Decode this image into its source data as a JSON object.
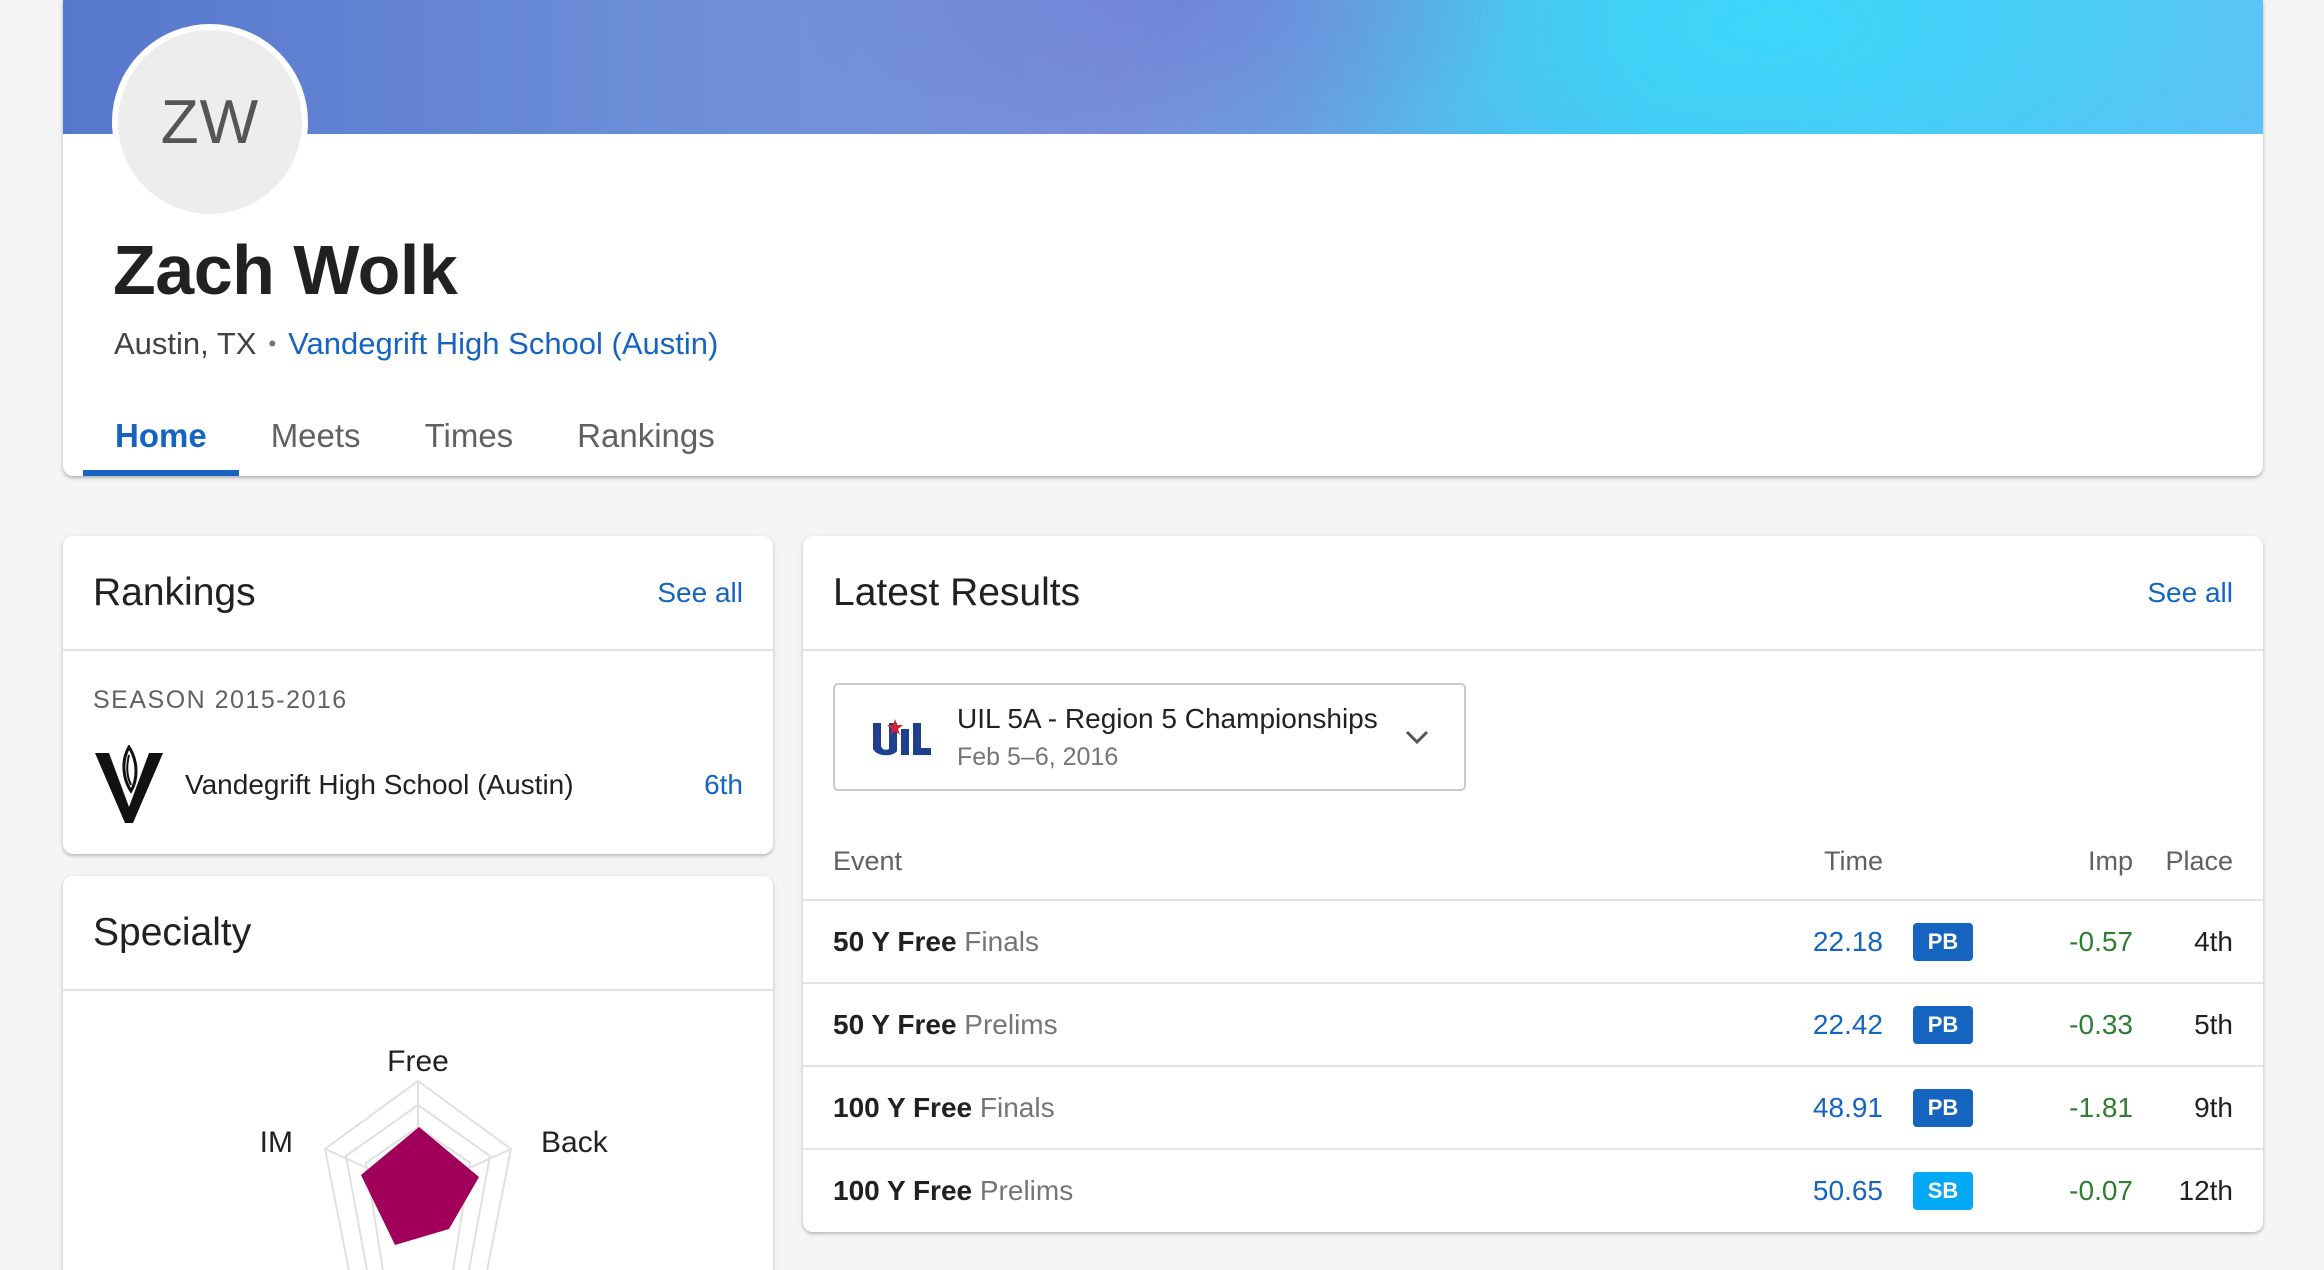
{
  "profile": {
    "initials": "ZW",
    "name": "Zach Wolk",
    "location": "Austin, TX",
    "separator": "•",
    "school": "Vandegrift High School (Austin)"
  },
  "tabs": [
    {
      "label": "Home",
      "active": true
    },
    {
      "label": "Meets",
      "active": false
    },
    {
      "label": "Times",
      "active": false
    },
    {
      "label": "Rankings",
      "active": false
    }
  ],
  "rankings": {
    "title": "Rankings",
    "see_all": "See all",
    "season": "SEASON 2015-2016",
    "team": "Vandegrift High School (Austin)",
    "rank": "6th",
    "logo_icon": "vandegrift-v-logo"
  },
  "specialty": {
    "title": "Specialty",
    "axes": [
      "Free",
      "Back",
      "IM"
    ],
    "fill_color": "#a0005a"
  },
  "latest_results": {
    "title": "Latest Results",
    "see_all": "See all",
    "meet": {
      "name": "UIL 5A - Region 5 Championships",
      "date": "Feb 5–6, 2016",
      "logo_icon": "uil-logo",
      "dropdown_icon": "chevron-down-icon"
    },
    "columns": {
      "event": "Event",
      "time": "Time",
      "imp": "Imp",
      "place": "Place"
    },
    "rows": [
      {
        "event": "50 Y Free",
        "round": "Finals",
        "time": "22.18",
        "badge": "PB",
        "imp": "-0.57",
        "place": "4th"
      },
      {
        "event": "50 Y Free",
        "round": "Prelims",
        "time": "22.42",
        "badge": "PB",
        "imp": "-0.33",
        "place": "5th"
      },
      {
        "event": "100 Y Free",
        "round": "Finals",
        "time": "48.91",
        "badge": "PB",
        "imp": "-1.81",
        "place": "9th"
      },
      {
        "event": "100 Y Free",
        "round": "Prelims",
        "time": "50.65",
        "badge": "SB",
        "imp": "-0.07",
        "place": "12th"
      }
    ],
    "badge_colors": {
      "PB": "#1565c0",
      "SB": "#03a9f4"
    },
    "improvement_color": "#2e7d32"
  },
  "colors": {
    "accent": "#1565c0",
    "background": "#f5f5f5"
  }
}
